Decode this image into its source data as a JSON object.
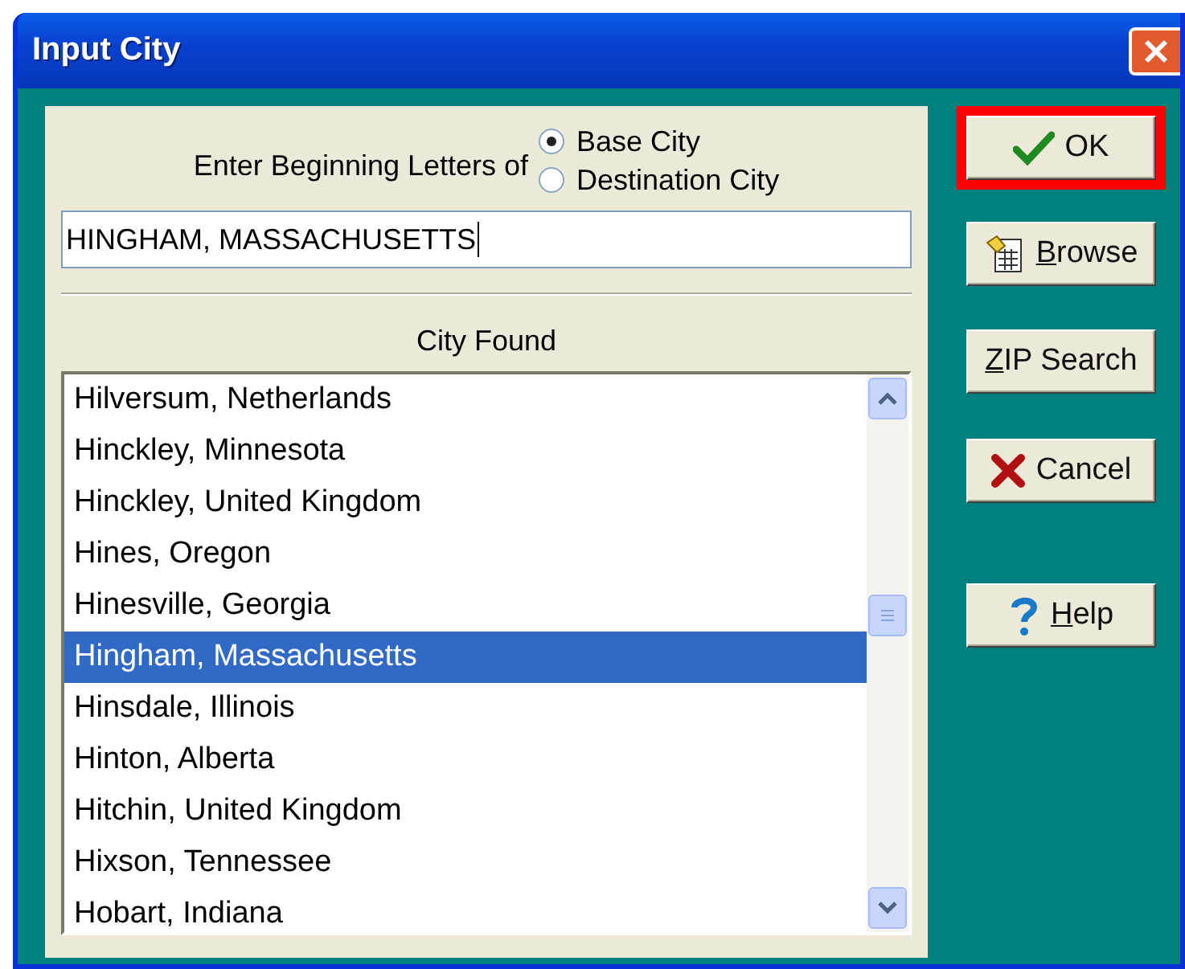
{
  "window": {
    "title": "Input City"
  },
  "prompt": "Enter Beginning Letters of",
  "city_type": [
    {
      "label": "Base City",
      "selected": true
    },
    {
      "label": "Destination City",
      "selected": false
    }
  ],
  "search": {
    "value": "HINGHAM, MASSACHUSETTS"
  },
  "list_heading": "City Found",
  "cities": [
    {
      "label": "Hilversum, Netherlands",
      "selected": false
    },
    {
      "label": "Hinckley, Minnesota",
      "selected": false
    },
    {
      "label": "Hinckley, United Kingdom",
      "selected": false
    },
    {
      "label": "Hines, Oregon",
      "selected": false
    },
    {
      "label": "Hinesville, Georgia",
      "selected": false
    },
    {
      "label": "Hingham, Massachusetts",
      "selected": true
    },
    {
      "label": "Hinsdale, Illinois",
      "selected": false
    },
    {
      "label": "Hinton, Alberta",
      "selected": false
    },
    {
      "label": "Hitchin, United Kingdom",
      "selected": false
    },
    {
      "label": "Hixson, Tennessee",
      "selected": false
    },
    {
      "label": "Hobart, Indiana",
      "selected": false
    }
  ],
  "buttons": [
    {
      "kind": "ok",
      "label": "OK",
      "mnemonic": false,
      "highlighted": true
    },
    {
      "kind": "browse",
      "label": "Browse",
      "mnemonic": true,
      "highlighted": false
    },
    {
      "kind": "zip",
      "label": "ZIP Search",
      "mnemonic": true,
      "highlighted": false
    },
    {
      "kind": "cancel",
      "label": "Cancel",
      "mnemonic": false,
      "highlighted": false
    },
    {
      "kind": "help",
      "label": "Help",
      "mnemonic": true,
      "highlighted": false
    }
  ]
}
